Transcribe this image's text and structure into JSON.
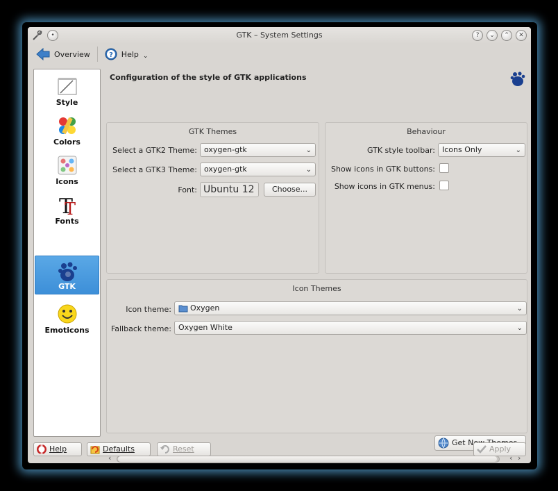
{
  "window": {
    "title": "GTK – System Settings"
  },
  "toolbar": {
    "overview_label": "Overview",
    "help_label": "Help"
  },
  "sidebar": {
    "items": [
      {
        "label": "Style",
        "icon": "style-icon"
      },
      {
        "label": "Colors",
        "icon": "colors-icon"
      },
      {
        "label": "Icons",
        "icon": "icons-icon"
      },
      {
        "label": "Fonts",
        "icon": "fonts-icon"
      },
      {
        "label": "GTK",
        "icon": "gtk-icon",
        "active": true
      },
      {
        "label": "Emoticons",
        "icon": "emoticons-icon"
      }
    ]
  },
  "main": {
    "header": "Configuration of the style of GTK applications",
    "gtk_themes": {
      "title": "GTK Themes",
      "gtk2_label": "Select a GTK2 Theme:",
      "gtk2_value": "oxygen-gtk",
      "gtk3_label": "Select a GTK3 Theme:",
      "gtk3_value": "oxygen-gtk",
      "font_label": "Font:",
      "font_value": "Ubuntu 12",
      "choose_label": "Choose..."
    },
    "behaviour": {
      "title": "Behaviour",
      "toolbar_style_label": "GTK style toolbar:",
      "toolbar_style_value": "Icons Only",
      "buttons_icons_label": "Show icons in GTK buttons:",
      "buttons_icons_checked": false,
      "menus_icons_label": "Show icons in GTK menus:",
      "menus_icons_checked": false
    },
    "icon_themes": {
      "title": "Icon Themes",
      "icon_theme_label": "Icon theme:",
      "icon_theme_value": "Oxygen",
      "fallback_label": "Fallback theme:",
      "fallback_value": "Oxygen White",
      "preview_icons": [
        "folder-home-icon",
        "folder-icon",
        "trash-icon",
        "printer-icon",
        "drive-icon",
        "computer-icon",
        "help-icon",
        "media-play-icon",
        "arrow-up-icon"
      ],
      "get_new_themes_label": "Get New Themes"
    }
  },
  "buttons": {
    "help": "Help",
    "defaults": "Defaults",
    "reset": "Reset",
    "apply": "Apply"
  },
  "colors": {
    "accent": "#3d8fd8",
    "window_bg": "#d9d6d2",
    "glow": "#5aaadc"
  }
}
